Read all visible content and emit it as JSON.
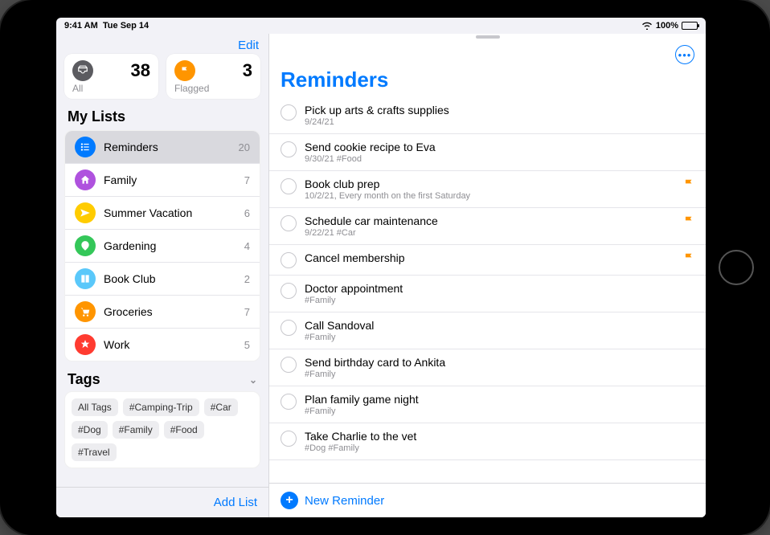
{
  "status": {
    "time": "9:41 AM",
    "date": "Tue Sep 14",
    "battery_pct": "100%"
  },
  "sidebar": {
    "edit": "Edit",
    "cards": [
      {
        "label": "All",
        "count": "38",
        "color": "#5b5b60"
      },
      {
        "label": "Flagged",
        "count": "3",
        "color": "#ff9500"
      }
    ],
    "my_lists_header": "My Lists",
    "lists": [
      {
        "name": "Reminders",
        "count": "20",
        "color": "#007aff",
        "selected": true
      },
      {
        "name": "Family",
        "count": "7",
        "color": "#af52de",
        "selected": false
      },
      {
        "name": "Summer Vacation",
        "count": "6",
        "color": "#ffcc00",
        "selected": false
      },
      {
        "name": "Gardening",
        "count": "4",
        "color": "#34c759",
        "selected": false
      },
      {
        "name": "Book Club",
        "count": "2",
        "color": "#5ac8fa",
        "selected": false
      },
      {
        "name": "Groceries",
        "count": "7",
        "color": "#ff9500",
        "selected": false
      },
      {
        "name": "Work",
        "count": "5",
        "color": "#ff3b30",
        "selected": false
      }
    ],
    "tags_header": "Tags",
    "tags": [
      "All Tags",
      "#Camping-Trip",
      "#Car",
      "#Dog",
      "#Family",
      "#Food",
      "#Travel"
    ],
    "add_list": "Add List"
  },
  "main": {
    "title": "Reminders",
    "new_reminder": "New Reminder",
    "items": [
      {
        "title": "Pick up arts & crafts supplies",
        "sub": "9/24/21",
        "tags": "",
        "flagged": false
      },
      {
        "title": "Send cookie recipe to Eva",
        "sub": "9/30/21",
        "tags": "#Food",
        "flagged": false
      },
      {
        "title": "Book club prep",
        "sub": "10/2/21, Every month on the first Saturday",
        "tags": "",
        "flagged": true
      },
      {
        "title": "Schedule car maintenance",
        "sub": "9/22/21",
        "tags": "#Car",
        "flagged": true
      },
      {
        "title": "Cancel membership",
        "sub": "",
        "tags": "",
        "flagged": true
      },
      {
        "title": "Doctor appointment",
        "sub": "",
        "tags": "#Family",
        "flagged": false
      },
      {
        "title": "Call Sandoval",
        "sub": "",
        "tags": "#Family",
        "flagged": false
      },
      {
        "title": "Send birthday card to Ankita",
        "sub": "",
        "tags": "#Family",
        "flagged": false
      },
      {
        "title": "Plan family game night",
        "sub": "",
        "tags": "#Family",
        "flagged": false
      },
      {
        "title": "Take Charlie to the vet",
        "sub": "",
        "tags": "#Dog #Family",
        "flagged": false
      }
    ]
  }
}
